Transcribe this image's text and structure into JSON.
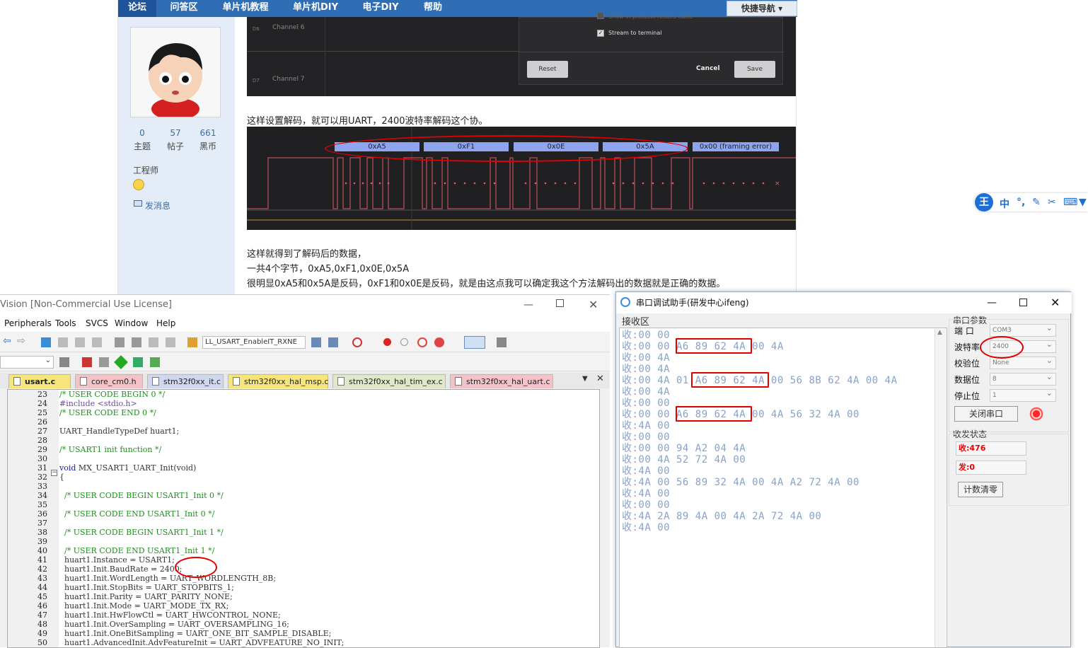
{
  "forum": {
    "nav": {
      "items": [
        "论坛",
        "问答区",
        "单片机教程",
        "单片机DIY",
        "电子DIY",
        "帮助"
      ],
      "quick_nav": "快捷导航"
    },
    "profile": {
      "stats": [
        {
          "value": "0",
          "label": "主题"
        },
        {
          "value": "57",
          "label": "帖子"
        },
        {
          "value": "661",
          "label": "黑币"
        }
      ],
      "rank": "工程师",
      "message_link": "发消息"
    },
    "logic_dialog": {
      "channel_6": "Channel 6",
      "channel_7": "Channel 7",
      "d6": "D6",
      "d7": "D7",
      "option_protocol": "Show in protocol results table",
      "option_terminal": "Stream to terminal",
      "reset": "Reset",
      "cancel": "Cancel",
      "save": "Save"
    },
    "text1": "这样设置解码，就可以用UART，2400波特率解码这个协。",
    "decoded_bytes": [
      "0xA5",
      "0xF1",
      "0x0E",
      "0x5A",
      "0x00 (framing error)"
    ],
    "text2": "这样就得到了解码后的数据，",
    "text3": "一共4个字节，0xA5,0xF1,0x0E,0x5A",
    "text4": "很明显0xA5和0x5A是反码，0xF1和0x0E是反码，就是由这点我可以确定我这个方法解码出的数据就是正确的数据。"
  },
  "keil": {
    "title": "Vision  [Non-Commercial Use License]",
    "menu": [
      "Peripherals",
      "Tools",
      "SVCS",
      "Window",
      "Help"
    ],
    "target_function": "LL_USART_EnableIT_RXNE",
    "tabs": [
      "usart.c",
      "core_cm0.h",
      "stm32f0xx_it.c",
      "stm32f0xx_hal_msp.c",
      "stm32f0xx_hal_tim_ex.c",
      "stm32f0xx_hal_uart.c"
    ],
    "code": [
      {
        "n": "23",
        "t": "/* USER CODE BEGIN 0 */",
        "c": "cm"
      },
      {
        "n": "24",
        "t": "#include <stdio.h>",
        "c": "pp"
      },
      {
        "n": "25",
        "t": "/* USER CODE END 0 */",
        "c": "cm"
      },
      {
        "n": "26",
        "t": "",
        "c": ""
      },
      {
        "n": "27",
        "t": "UART_HandleTypeDef huart1;",
        "c": ""
      },
      {
        "n": "28",
        "t": "",
        "c": ""
      },
      {
        "n": "29",
        "t": "/* USART1 init function */",
        "c": "cm"
      },
      {
        "n": "30",
        "t": "",
        "c": ""
      },
      {
        "n": "31",
        "t": "void MX_USART1_UART_Init(void)",
        "c": "fn"
      },
      {
        "n": "32",
        "t": "{",
        "c": ""
      },
      {
        "n": "33",
        "t": "",
        "c": ""
      },
      {
        "n": "34",
        "t": "  /* USER CODE BEGIN USART1_Init 0 */",
        "c": "cm"
      },
      {
        "n": "35",
        "t": "",
        "c": ""
      },
      {
        "n": "36",
        "t": "  /* USER CODE END USART1_Init 0 */",
        "c": "cm"
      },
      {
        "n": "37",
        "t": "",
        "c": ""
      },
      {
        "n": "38",
        "t": "  /* USER CODE BEGIN USART1_Init 1 */",
        "c": "cm"
      },
      {
        "n": "39",
        "t": "",
        "c": ""
      },
      {
        "n": "40",
        "t": "  /* USER CODE END USART1_Init 1 */",
        "c": "cm"
      },
      {
        "n": "41",
        "t": "  huart1.Instance = USART1;",
        "c": ""
      },
      {
        "n": "42",
        "t": "  huart1.Init.BaudRate = 2400;",
        "c": ""
      },
      {
        "n": "43",
        "t": "  huart1.Init.WordLength = UART_WORDLENGTH_8B;",
        "c": ""
      },
      {
        "n": "44",
        "t": "  huart1.Init.StopBits = UART_STOPBITS_1;",
        "c": ""
      },
      {
        "n": "45",
        "t": "  huart1.Init.Parity = UART_PARITY_NONE;",
        "c": ""
      },
      {
        "n": "46",
        "t": "  huart1.Init.Mode = UART_MODE_TX_RX;",
        "c": ""
      },
      {
        "n": "47",
        "t": "  huart1.Init.HwFlowCtl = UART_HWCONTROL_NONE;",
        "c": ""
      },
      {
        "n": "48",
        "t": "  huart1.Init.OverSampling = UART_OVERSAMPLING_16;",
        "c": ""
      },
      {
        "n": "49",
        "t": "  huart1.Init.OneBitSampling = UART_ONE_BIT_SAMPLE_DISABLE;",
        "c": ""
      },
      {
        "n": "50",
        "t": "  huart1.AdvancedInit.AdvFeatureInit = UART_ADVFEATURE_NO_INIT;",
        "c": ""
      }
    ]
  },
  "serial": {
    "title": "串口调试助手(研发中心ifeng)",
    "recv_label": "接收区",
    "recv_lines": [
      "收:00 00",
      "收:00 00 A6 89 62 4A 00 4A",
      "收:00 4A",
      "收:00 4A",
      "收:00 4A 01 A6 89 62 4A 00 56 8B 62 4A 00 4A",
      "收:00 4A",
      "收:00 00",
      "收:00 00 A6 89 62 4A 00 4A 56 32 4A 00",
      "收:4A 00",
      "收:00 00",
      "收:00 00 94 A2 04 4A",
      "收:00 4A 52 72 4A 00",
      "收:4A 00",
      "收:4A 00 56 89 32 4A 00 4A A2 72 4A 00",
      "收:4A 00",
      "收:00 00",
      "收:4A 2A 89 4A 00 4A 2A 72 4A 00",
      "收:4A 00"
    ],
    "params_title": "串口参数",
    "port_label": "端  口",
    "port_value": "COM3",
    "baud_label": "波特率",
    "baud_value": "2400",
    "parity_label": "校验位",
    "parity_value": "None",
    "data_label": "数据位",
    "data_value": "8",
    "stop_label": "停止位",
    "stop_value": "1",
    "close_button": "关闭串口",
    "status_title": "收发状态",
    "rx_count": "收:476",
    "tx_count": "发:0",
    "clear_button": "计数清零"
  },
  "ime": {
    "logo": "王",
    "lang": "中"
  }
}
